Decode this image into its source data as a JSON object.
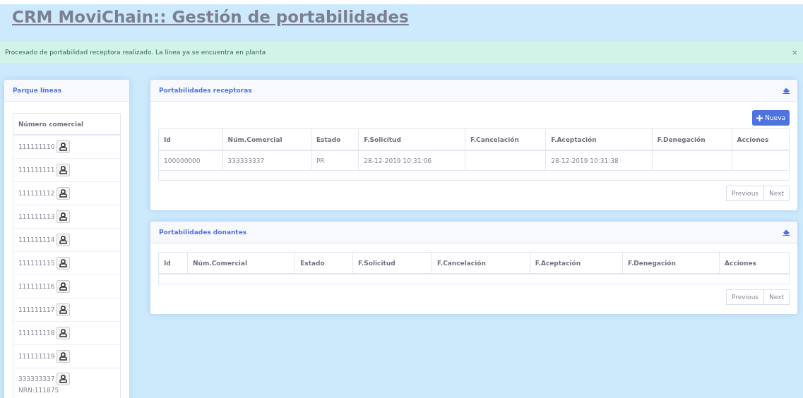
{
  "title": "CRM MoviChain:: Gestión de portabilidades",
  "alert": {
    "message": "Procesado de portabilidad receptora realizado. La línea ya se encuentra en planta",
    "close": "×"
  },
  "lines_panel": {
    "title": "Parque líneas",
    "column": "Número comercial",
    "rows": [
      {
        "number": "111111110"
      },
      {
        "number": "111111111"
      },
      {
        "number": "111111112"
      },
      {
        "number": "111111113"
      },
      {
        "number": "111111114"
      },
      {
        "number": "111111115"
      },
      {
        "number": "111111116"
      },
      {
        "number": "111111117"
      },
      {
        "number": "111111118"
      },
      {
        "number": "111111119"
      },
      {
        "number": "333333337",
        "note": "NRN:111875"
      }
    ]
  },
  "panels": [
    {
      "title": "Portabilidades receptoras",
      "new_button": "Nueva",
      "columns": [
        "Id",
        "Núm.Comercial",
        "Estado",
        "F.Solicitud",
        "F.Cancelación",
        "F.Aceptación",
        "F.Denegación",
        "Acciones"
      ],
      "rows": [
        [
          "100000000",
          "333333337",
          "PR",
          "28-12-2019 10:31:06",
          "",
          "28-12-2019 10:31:38",
          "",
          ""
        ]
      ],
      "pagination": [
        "Previous",
        "Next"
      ]
    },
    {
      "title": "Portabilidades donantes",
      "columns": [
        "Id",
        "Núm.Comercial",
        "Estado",
        "F.Solicitud",
        "F.Cancelación",
        "F.Aceptación",
        "F.Denegación",
        "Acciones"
      ],
      "pagination": [
        "Previous",
        "Next"
      ]
    }
  ]
}
